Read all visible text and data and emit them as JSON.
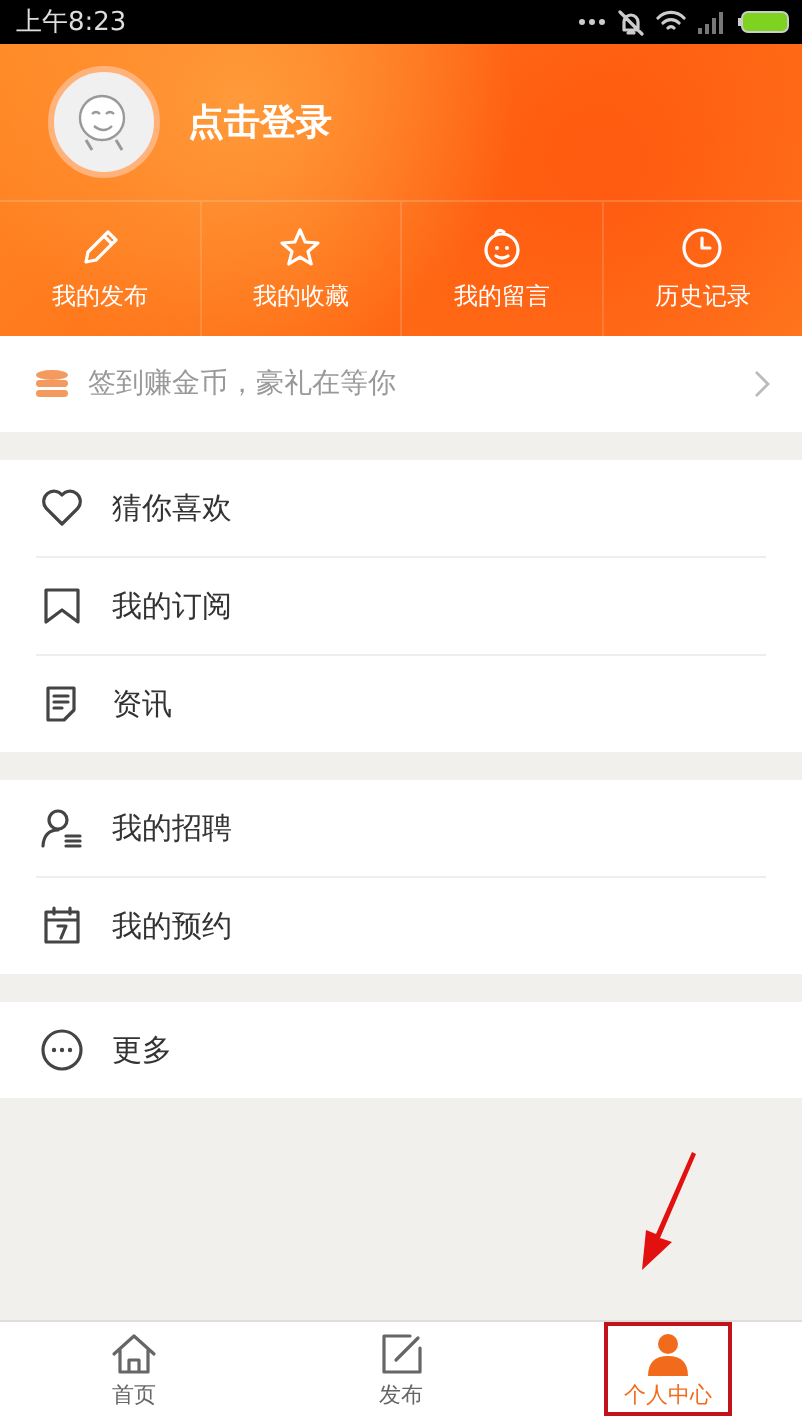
{
  "status_bar": {
    "time": "上午8:23"
  },
  "profile": {
    "login_label": "点击登录"
  },
  "shortcuts": [
    {
      "label": "我的发布"
    },
    {
      "label": "我的收藏"
    },
    {
      "label": "我的留言"
    },
    {
      "label": "历史记录"
    }
  ],
  "checkin_banner": {
    "text": "签到赚金币，豪礼在等你"
  },
  "menu_groups": [
    [
      {
        "label": "猜你喜欢"
      },
      {
        "label": "我的订阅"
      },
      {
        "label": "资讯"
      }
    ],
    [
      {
        "label": "我的招聘"
      },
      {
        "label": "我的预约"
      }
    ],
    [
      {
        "label": "更多"
      }
    ]
  ],
  "tabs": [
    {
      "label": "首页",
      "selected": false
    },
    {
      "label": "发布",
      "selected": false
    },
    {
      "label": "个人中心",
      "selected": true
    }
  ]
}
